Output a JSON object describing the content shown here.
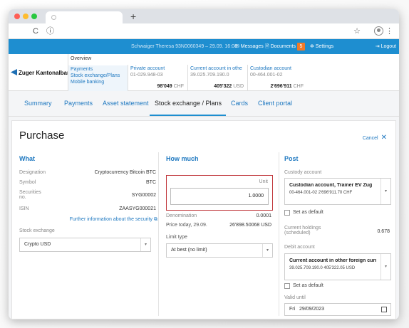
{
  "browser": {
    "new_tab": "+",
    "reload": "C",
    "info": "ⓘ",
    "star": "☆",
    "kebab": "⋮"
  },
  "topnav": {
    "user": "Schwaiger Theresa   93N0060349 – 29.09. 16:08",
    "messages": "✉ Messages",
    "documents": "🗎 Documents",
    "documents_badge": "5",
    "settings": "✲ Settings",
    "logout": "⇥ Logout"
  },
  "bank": {
    "name": "Zuger Kantonalbank",
    "menu": {
      "overview": "Overview",
      "payments": "Payments",
      "stock": "Stock exchange/Plans",
      "mobile": "Mobile banking"
    },
    "accounts": [
      {
        "name": "Private account",
        "number": "01-029.948-03",
        "balance": "98'049",
        "currency": "CHF"
      },
      {
        "name": "Current account in othe",
        "number": "39.025.709.190.0",
        "balance": "405'322",
        "currency": "USD"
      },
      {
        "name": "Custodian account",
        "number": "00-464.001-02",
        "balance": "2'696'911",
        "currency": "CHF"
      }
    ]
  },
  "tabs": [
    "Summary",
    "Payments",
    "Asset statement",
    "Stock exchange / Plans",
    "Cards",
    "Client portal"
  ],
  "page": {
    "title": "Purchase",
    "cancel": "Cancel",
    "cancel_icon": "✕"
  },
  "what": {
    "heading": "What",
    "designation_label": "Designation",
    "designation": "Cryptocurrency Bitcoin BTC",
    "symbol_label": "Symbol",
    "symbol": "BTC",
    "securities_label": "Securities no.",
    "securities": "SYG00002",
    "isin_label": "ISIN",
    "isin": "ZAASYG000021",
    "further": "Further information about the security  ⧉",
    "exchange_label": "Stock exchange",
    "exchange": "Crypto USD"
  },
  "howmuch": {
    "heading": "How much",
    "unit_label": "Unit",
    "unit": "1.0000",
    "denomination_label": "Denomination",
    "denomination": "0.0001",
    "price_label": "Price today, 29.09.",
    "price": "26'898.50068 USD",
    "limit_label": "Limit type",
    "limit": "At best (no limit)"
  },
  "post": {
    "heading": "Post",
    "custody_label": "Custody account",
    "custody_title": "Custodian account, Trainer EV Zug",
    "custody_sub": "00-464.001-02        2'696'911.70 CHF",
    "set_default": "Set as default",
    "holdings_label": "Current holdings (scheduled)",
    "holdings": "0.678",
    "debit_label": "Debit account",
    "debit_title": "Current account in other foreign currency",
    "debit_sub": "39.025.709.190.0        405'322.05 USD",
    "set_default2": "Set as default",
    "valid_label": "Valid until",
    "valid_day": "Fri",
    "valid_date": "29/09/2023"
  }
}
